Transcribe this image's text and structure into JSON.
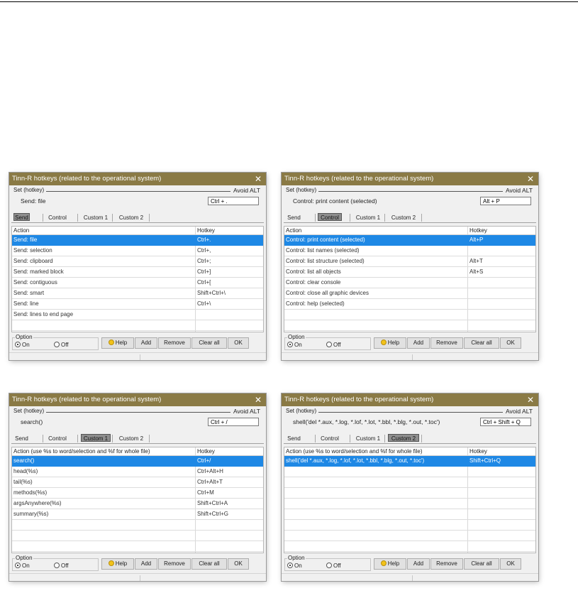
{
  "dialogs": [
    {
      "title": "Tinn-R hotkeys (related to the operational system)",
      "group_label": "Set (hotkey)",
      "avoid_label": "Avoid ALT",
      "current_text": "Send: file",
      "hotkey_value": "Ctrl + .",
      "tabs": [
        "Send",
        "Control",
        "Custom 1",
        "Custom 2"
      ],
      "selected_tab": 0,
      "col_action": "Action",
      "col_hotkey": "Hotkey",
      "rows": [
        {
          "action": "Send: file",
          "hotkey": "Ctrl+."
        },
        {
          "action": "Send: selection",
          "hotkey": "Ctrl+,"
        },
        {
          "action": "Send: clipboard",
          "hotkey": "Ctrl+;"
        },
        {
          "action": "Send: marked block",
          "hotkey": "Ctrl+]"
        },
        {
          "action": "Send: contiguous",
          "hotkey": "Ctrl+["
        },
        {
          "action": "Send: smart",
          "hotkey": "Shift+Ctrl+\\"
        },
        {
          "action": "Send: line",
          "hotkey": "Ctrl+\\"
        },
        {
          "action": "Send: lines to end page",
          "hotkey": ""
        }
      ],
      "selected_row": 0,
      "option_label": "Option",
      "on_label": "On",
      "off_label": "Off",
      "buttons": {
        "help": "Help",
        "add": "Add",
        "remove": "Remove",
        "clear": "Clear all",
        "ok": "OK"
      }
    },
    {
      "title": "Tinn-R hotkeys (related to the operational system)",
      "group_label": "Set (hotkey)",
      "avoid_label": "Avoid ALT",
      "current_text": "Control: print content (selected)",
      "hotkey_value": "Alt + P",
      "tabs": [
        "Send",
        "Control",
        "Custom 1",
        "Custom 2"
      ],
      "selected_tab": 1,
      "col_action": "Action",
      "col_hotkey": "Hotkey",
      "rows": [
        {
          "action": "Control: print content (selected)",
          "hotkey": "Alt+P"
        },
        {
          "action": "Control: list names (selected)",
          "hotkey": ""
        },
        {
          "action": "Control: list structure (selected)",
          "hotkey": "Alt+T"
        },
        {
          "action": "Control: list all objects",
          "hotkey": "Alt+S"
        },
        {
          "action": "Control: clear console",
          "hotkey": ""
        },
        {
          "action": "Control: close all graphic devices",
          "hotkey": ""
        },
        {
          "action": "Control: help (selected)",
          "hotkey": ""
        }
      ],
      "selected_row": 0,
      "option_label": "Option",
      "on_label": "On",
      "off_label": "Off",
      "buttons": {
        "help": "Help",
        "add": "Add",
        "remove": "Remove",
        "clear": "Clear all",
        "ok": "OK"
      }
    },
    {
      "title": "Tinn-R hotkeys (related to the operational system)",
      "group_label": "Set (hotkey)",
      "avoid_label": "Avoid ALT",
      "current_text": "search()",
      "hotkey_value": "Ctrl + /",
      "tabs": [
        "Send",
        "Control",
        "Custom 1",
        "Custom 2"
      ],
      "selected_tab": 2,
      "col_action": "Action (use %s to word/selection and %f for whole file)",
      "col_hotkey": "Hotkey",
      "rows": [
        {
          "action": "search()",
          "hotkey": "Ctrl+/"
        },
        {
          "action": "head(%s)",
          "hotkey": "Ctrl+Alt+H"
        },
        {
          "action": "tail(%s)",
          "hotkey": "Ctrl+Alt+T"
        },
        {
          "action": "methods(%s)",
          "hotkey": "Ctrl+M"
        },
        {
          "action": "argsAnywhere(%s)",
          "hotkey": "Shift+Ctrl+A"
        },
        {
          "action": "summary(%s)",
          "hotkey": "Shift+Ctrl+G"
        }
      ],
      "selected_row": 0,
      "option_label": "Option",
      "on_label": "On",
      "off_label": "Off",
      "buttons": {
        "help": "Help",
        "add": "Add",
        "remove": "Remove",
        "clear": "Clear all",
        "ok": "OK"
      }
    },
    {
      "title": "Tinn-R hotkeys (related to the operational system)",
      "group_label": "Set (hotkey)",
      "avoid_label": "Avoid ALT",
      "current_text": "shell('del *.aux, *.log, *.lof, *.lot, *.bbl, *.blg, *.out, *.toc')",
      "hotkey_value": "Ctrl + Shift + Q",
      "tabs": [
        "Send",
        "Control",
        "Custom 1",
        "Custom 2"
      ],
      "selected_tab": 3,
      "col_action": "Action (use %s to word/selection and %f for whole file)",
      "col_hotkey": "Hotkey",
      "rows": [
        {
          "action": "shell('del *.aux, *.log, *.lof, *.lot, *.bbl, *.blg, *.out, *.toc')",
          "hotkey": "Shift+Ctrl+Q"
        }
      ],
      "selected_row": 0,
      "option_label": "Option",
      "on_label": "On",
      "off_label": "Off",
      "buttons": {
        "help": "Help",
        "add": "Add",
        "remove": "Remove",
        "clear": "Clear all",
        "ok": "OK"
      }
    }
  ]
}
